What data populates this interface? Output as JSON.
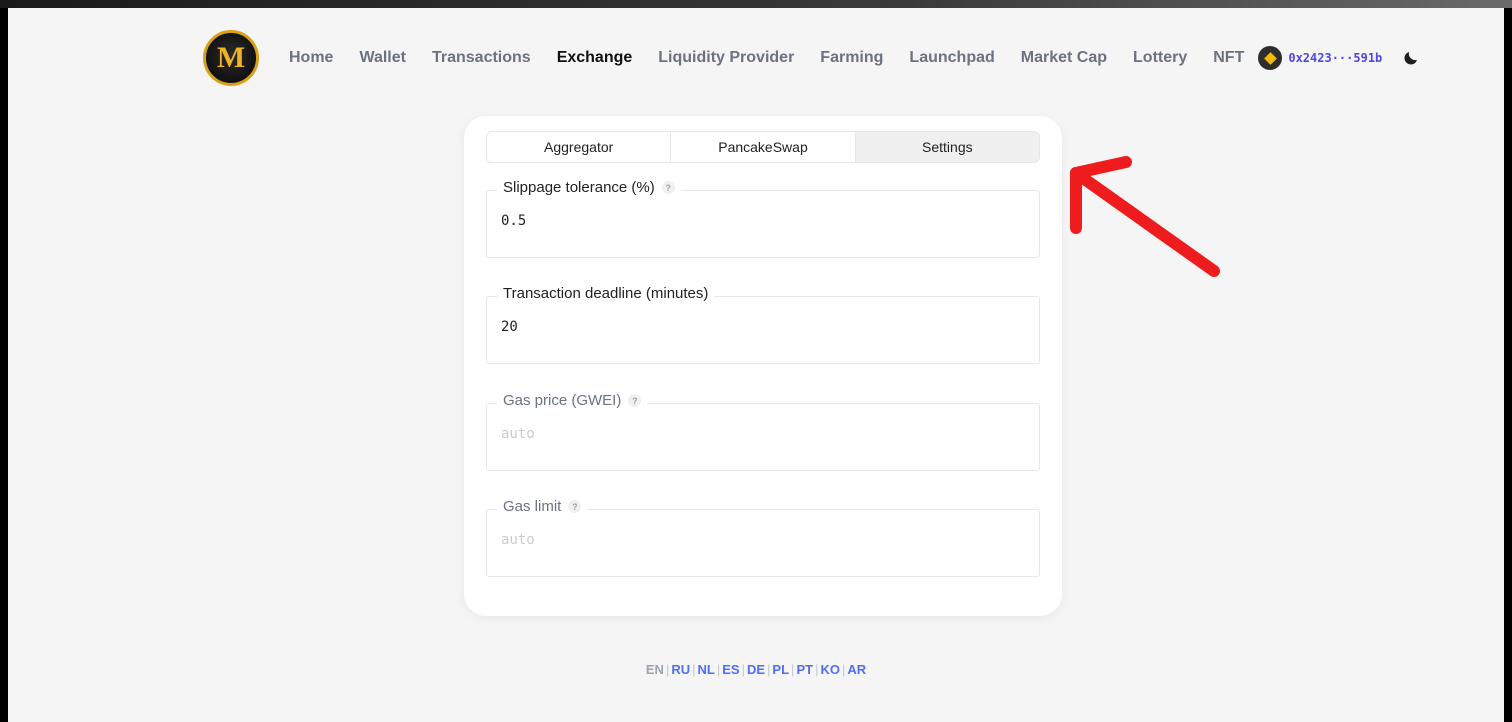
{
  "logo": {
    "letter": "M"
  },
  "nav": {
    "items": [
      {
        "label": "Home",
        "active": false
      },
      {
        "label": "Wallet",
        "active": false
      },
      {
        "label": "Transactions",
        "active": false
      },
      {
        "label": "Exchange",
        "active": true
      },
      {
        "label": "Liquidity Provider",
        "active": false
      },
      {
        "label": "Farming",
        "active": false
      },
      {
        "label": "Launchpad",
        "active": false
      },
      {
        "label": "Market Cap",
        "active": false
      },
      {
        "label": "Lottery",
        "active": false
      },
      {
        "label": "NFT",
        "active": false
      }
    ],
    "wallet_address": "0x2423···591b",
    "chain_icon": "bnb-icon",
    "theme_icon": "moon-icon"
  },
  "tabs": [
    {
      "label": "Aggregator",
      "active": false
    },
    {
      "label": "PancakeSwap",
      "active": false
    },
    {
      "label": "Settings",
      "active": true
    }
  ],
  "settings": {
    "slippage": {
      "label": "Slippage tolerance (%)",
      "value": "0.5",
      "placeholder": ""
    },
    "deadline": {
      "label": "Transaction deadline (minutes)",
      "value": "20",
      "placeholder": ""
    },
    "gas_price": {
      "label": "Gas price (GWEI)",
      "value": "",
      "placeholder": "auto"
    },
    "gas_limit": {
      "label": "Gas limit",
      "value": "",
      "placeholder": "auto"
    },
    "help_glyph": "?"
  },
  "languages": [
    {
      "code": "EN",
      "active": true
    },
    {
      "code": "RU",
      "active": false
    },
    {
      "code": "NL",
      "active": false
    },
    {
      "code": "ES",
      "active": false
    },
    {
      "code": "DE",
      "active": false
    },
    {
      "code": "PL",
      "active": false
    },
    {
      "code": "PT",
      "active": false
    },
    {
      "code": "KO",
      "active": false
    },
    {
      "code": "AR",
      "active": false
    }
  ],
  "colors": {
    "accent": "#4f46e5",
    "link": "#4f6ef7",
    "annotation": "#ee1c1c",
    "logo_gold": "#f0b323"
  }
}
